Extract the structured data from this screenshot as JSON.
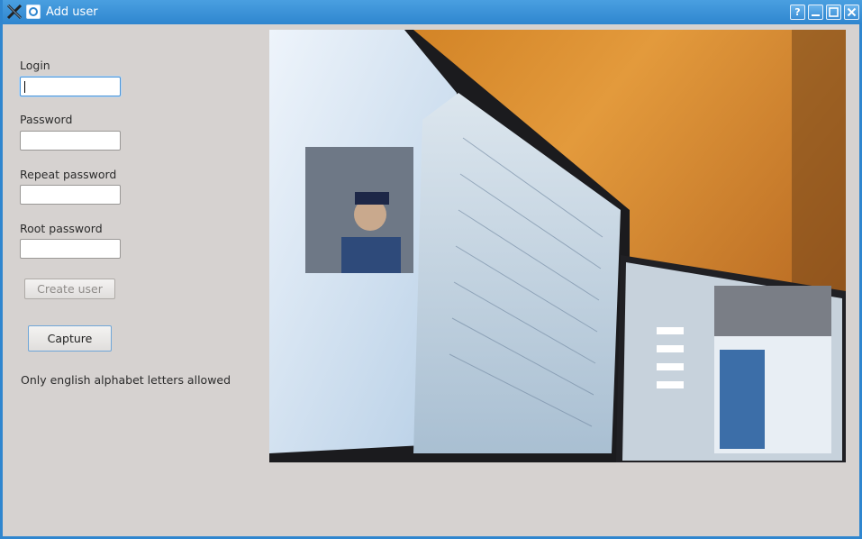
{
  "window": {
    "title": "Add user"
  },
  "titlebar_buttons": {
    "help": "?",
    "minimize": "_",
    "maximize": "□",
    "close": "✕"
  },
  "form": {
    "login_label": "Login",
    "login_value": "",
    "password_label": "Password",
    "password_value": "",
    "repeat_password_label": "Repeat password",
    "repeat_password_value": "",
    "root_password_label": "Root password",
    "root_password_value": "",
    "create_user_label": "Create user",
    "capture_label": "Capture",
    "hint": "Only english alphabet letters allowed"
  },
  "colors": {
    "titlebar": "#2f86cf",
    "window_bg": "#d6d2d0",
    "focus": "#4a94d6"
  },
  "icons": {
    "app": "x-app-icon",
    "window_menu": "window-menu-icon",
    "help": "help-icon",
    "minimize": "minimize-icon",
    "maximize": "maximize-icon",
    "close": "close-icon"
  }
}
